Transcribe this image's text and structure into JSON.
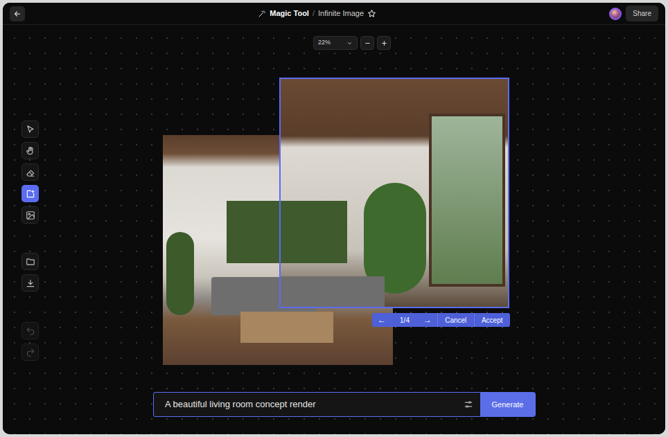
{
  "header": {
    "app": "Magic Tool",
    "separator": "/",
    "document": "Infinite Image",
    "favorite": false,
    "share": "Share"
  },
  "zoom": {
    "value": "22%"
  },
  "tools": [
    {
      "kind": "select",
      "selected": false
    },
    {
      "kind": "hand",
      "selected": false
    },
    {
      "kind": "eraser",
      "selected": false
    },
    {
      "kind": "frame",
      "selected": true
    },
    {
      "kind": "image",
      "selected": false
    }
  ],
  "files": [
    {
      "kind": "folder"
    },
    {
      "kind": "download"
    }
  ],
  "history": [
    {
      "kind": "undo",
      "disabled": true
    },
    {
      "kind": "redo",
      "disabled": true
    }
  ],
  "candidate": {
    "prev": "←",
    "counter": "1/4",
    "next": "→",
    "cancel": "Cancel",
    "accept": "Accept"
  },
  "prompt": {
    "value": "A beautiful living room concept render",
    "button": "Generate"
  }
}
